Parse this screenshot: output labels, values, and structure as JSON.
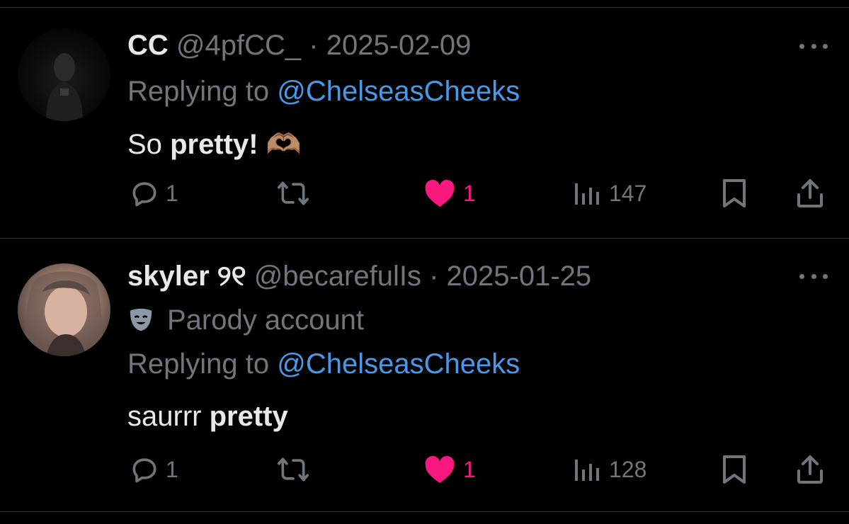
{
  "tweets": [
    {
      "name": "CC",
      "handle": "@4pfCC_",
      "dot": "·",
      "date": "2025-02-09",
      "replying_prefix": "Replying to",
      "replying_to": "@ChelseasCheeks",
      "text_plain": "So",
      "text_bold": "pretty!",
      "emoji": "🫶🏽",
      "replies": "1",
      "likes": "1",
      "views": "147"
    },
    {
      "name": "skyler",
      "name_suffix": "୨୧",
      "handle": "@becarefulIs",
      "dot": "·",
      "date": "2025-01-25",
      "badge_label": "Parody account",
      "replying_prefix": "Replying to",
      "replying_to": "@ChelseasCheeks",
      "text_plain": "saurrr",
      "text_bold": "pretty",
      "replies": "1",
      "likes": "1",
      "views": "128"
    }
  ],
  "colors": {
    "background": "#000000",
    "text": "#e7e9ea",
    "muted": "#71767b",
    "mention": "#4a99e9",
    "like": "#f91880",
    "divider": "#2f3336"
  },
  "icons": [
    "reply-icon",
    "retweet-icon",
    "heart-icon",
    "views-icon",
    "bookmark-icon",
    "share-icon",
    "more-icon",
    "parody-mask-icon"
  ]
}
